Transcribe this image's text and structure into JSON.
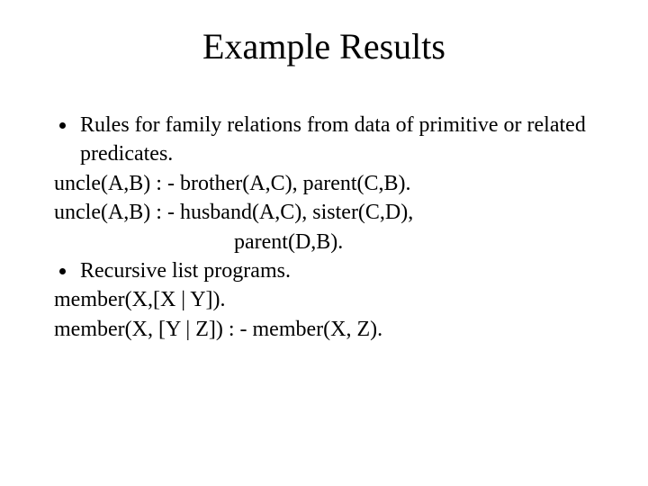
{
  "title": "Example Results",
  "bullet1": "Rules for family relations from data of primitive or related predicates.",
  "rule1": "uncle(A,B) : - brother(A,C), parent(C,B).",
  "rule2a": "uncle(A,B) : - husband(A,C), sister(C,D),",
  "rule2b": "parent(D,B).",
  "bullet2": "Recursive list programs.",
  "rule3": "member(X,[X | Y]).",
  "rule4": "member(X, [Y | Z]) : - member(X, Z)."
}
